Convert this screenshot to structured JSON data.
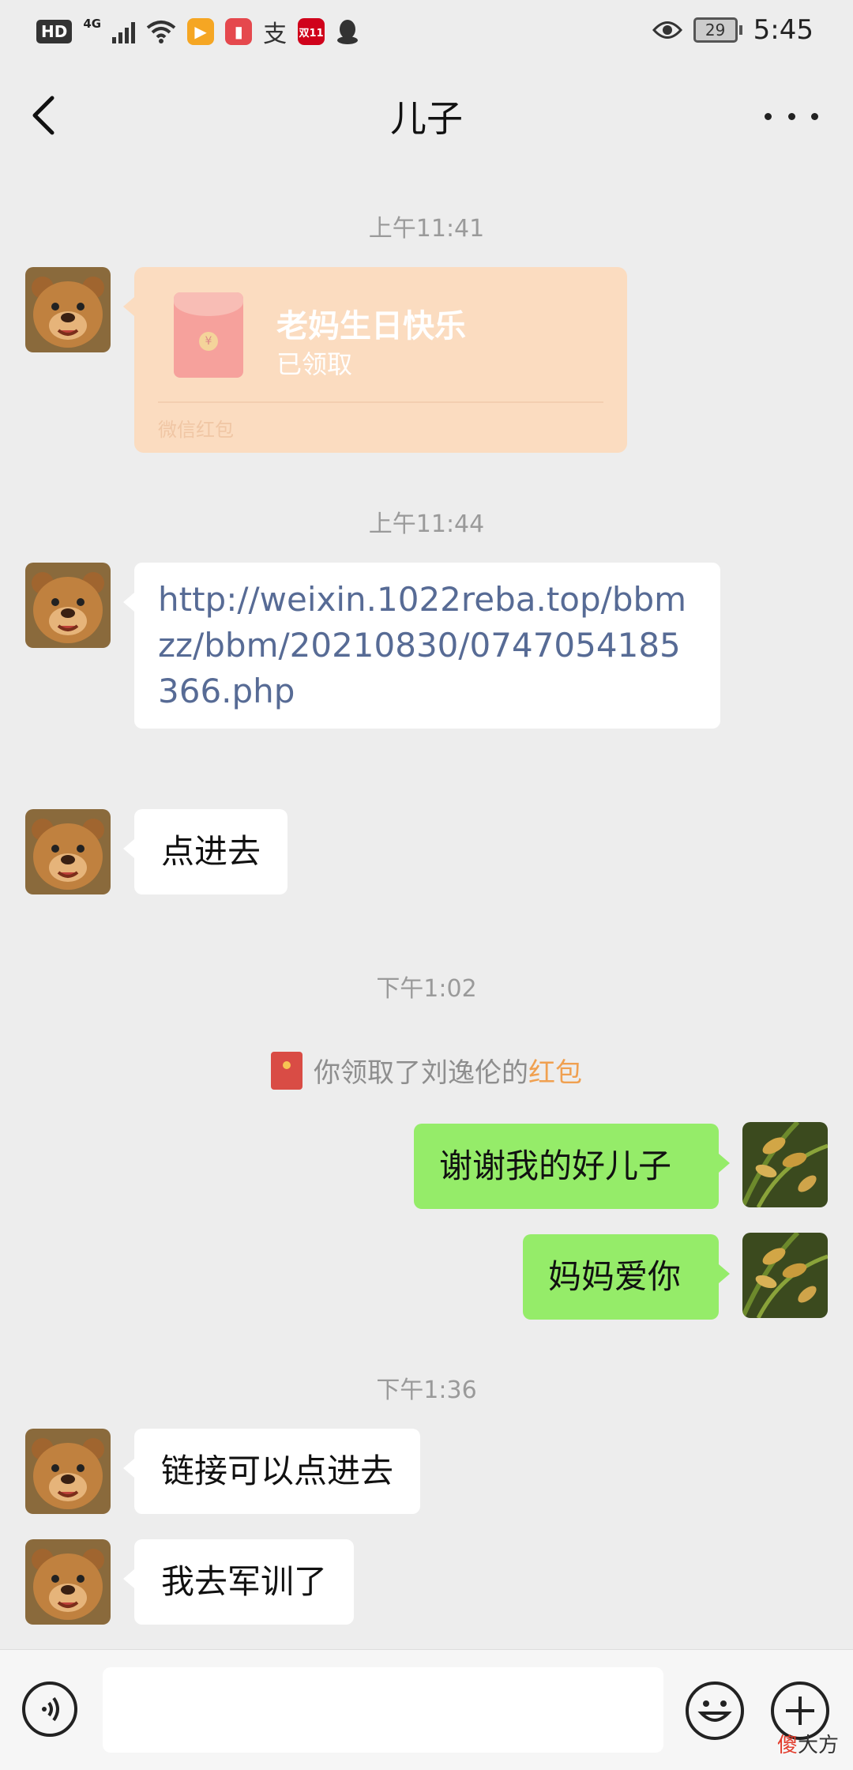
{
  "status_bar": {
    "hd": "HD",
    "network": "4G",
    "time": "5:45",
    "battery": "29",
    "app_icons": [
      "video-app-icon",
      "book-app-icon",
      "alipay-icon",
      "double11-icon",
      "qq-icon"
    ],
    "double11_label": "双11",
    "alipay_label": "支"
  },
  "nav": {
    "title": "儿子"
  },
  "messages": {
    "ts1": "上午11:41",
    "redpacket": {
      "title": "老妈生日快乐",
      "status": "已领取",
      "footer": "微信红包"
    },
    "ts2": "上午11:44",
    "link_text": "http://weixin.1022reba.top/bbmzz/bbm/20210830/0747054185366.php",
    "msg_click": "点进去",
    "ts3": "下午1:02",
    "sys_notice_prefix": "你领取了刘逸伦的",
    "sys_notice_link": "红包",
    "my_msg1": "谢谢我的好儿子",
    "my_msg2": "妈妈爱你",
    "ts4": "下午1:36",
    "msg_link_clickable": "链接可以点进去",
    "msg_training": "我去军训了"
  },
  "watermark": {
    "a": "傻",
    "b": "大方"
  },
  "colors": {
    "background": "#ededed",
    "my_bubble": "#95ec69",
    "link": "#576b95",
    "redpacket": "#fbdcc0"
  }
}
